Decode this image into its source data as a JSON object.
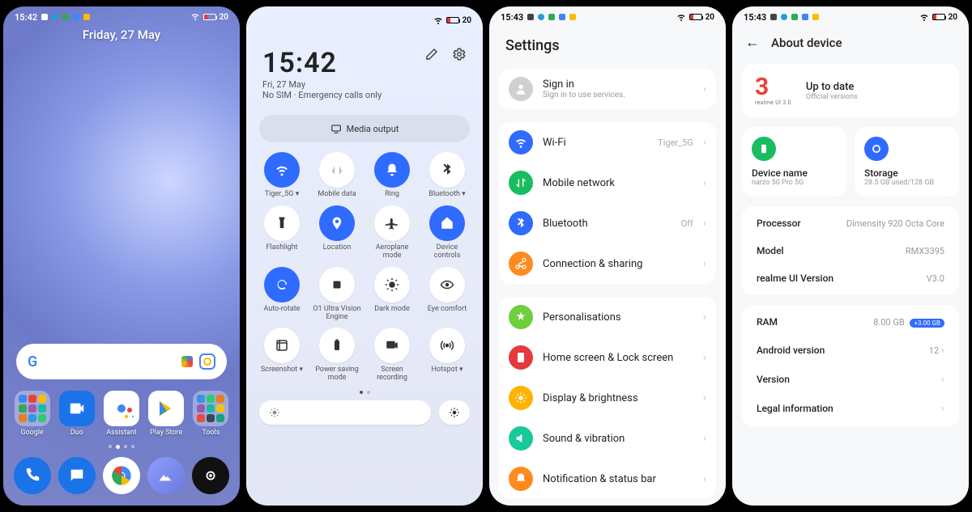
{
  "status": {
    "time_a": "15:42",
    "time_b": "15:43",
    "battery": "20"
  },
  "screen1": {
    "date": "Friday, 27 May",
    "apps": [
      {
        "label": "Google"
      },
      {
        "label": "Duo"
      },
      {
        "label": "Assistant"
      },
      {
        "label": "Play Store"
      },
      {
        "label": "Tools"
      }
    ]
  },
  "screen2": {
    "time": "15:42",
    "date": "Fri, 27 May",
    "sim": "No SIM · Emergency calls only",
    "media": "Media output",
    "tiles": [
      {
        "label": "Tiger_5G ▾"
      },
      {
        "label": "Mobile data"
      },
      {
        "label": "Ring"
      },
      {
        "label": "Bluetooth ▾"
      },
      {
        "label": "Flashlight"
      },
      {
        "label": "Location"
      },
      {
        "label": "Aeroplane mode"
      },
      {
        "label": "Device controls"
      },
      {
        "label": "Auto-rotate"
      },
      {
        "label": "O1 Ultra Vision Engine"
      },
      {
        "label": "Dark mode"
      },
      {
        "label": "Eye comfort"
      },
      {
        "label": "Screenshot ▾"
      },
      {
        "label": "Power saving mode"
      },
      {
        "label": "Screen recording"
      },
      {
        "label": "Hotspot ▾"
      }
    ]
  },
  "screen3": {
    "title": "Settings",
    "signin_t": "Sign in",
    "signin_s": "Sign in to use services.",
    "rows": [
      {
        "label": "Wi-Fi",
        "value": "Tiger_5G",
        "color": "ic-blue"
      },
      {
        "label": "Mobile network",
        "value": "",
        "color": "ic-green"
      },
      {
        "label": "Bluetooth",
        "value": "Off",
        "color": "ic-blue"
      },
      {
        "label": "Connection & sharing",
        "value": "",
        "color": "ic-orange"
      }
    ],
    "rows2": [
      {
        "label": "Personalisations",
        "color": "ic-lime"
      },
      {
        "label": "Home screen & Lock screen",
        "color": "ic-red"
      },
      {
        "label": "Display & brightness",
        "color": "ic-yellow"
      },
      {
        "label": "Sound & vibration",
        "color": "ic-teal"
      },
      {
        "label": "Notification & status bar",
        "color": "ic-orange"
      }
    ]
  },
  "screen4": {
    "title": "About device",
    "uptodate": "Up to date",
    "official": "Official versions",
    "brand": "realme UI 3.0",
    "device_name_t": "Device name",
    "device_name_v": "narzo 50 Pro 5G",
    "storage_t": "Storage",
    "storage_v": "28.5 GB used/128 GB",
    "rows": [
      {
        "k": "Processor",
        "v": "Dimensity 920 Octa Core"
      },
      {
        "k": "Model",
        "v": "RMX3395"
      },
      {
        "k": "realme UI Version",
        "v": "V3.0"
      }
    ],
    "ram_k": "RAM",
    "ram_v": "8.00 GB",
    "ram_ext": "+3.00 GB",
    "rows2": [
      {
        "k": "Android version",
        "v": "12"
      },
      {
        "k": "Version",
        "v": ""
      },
      {
        "k": "Legal information",
        "v": ""
      }
    ]
  }
}
